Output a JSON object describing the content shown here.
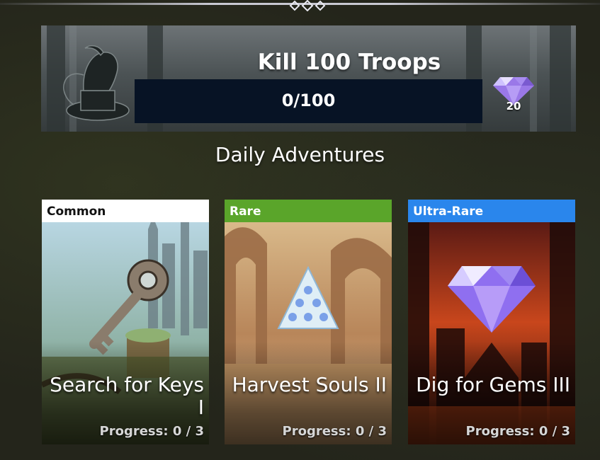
{
  "top_bar": {
    "ornament_icon": "diamond-ornament-icon"
  },
  "quest": {
    "title": "Kill 100 Troops",
    "progress_text": "0/100",
    "progress_fraction": 0,
    "reward": {
      "icon": "gem-icon",
      "count": "20"
    },
    "art_icon": "gargoyle-statue-icon"
  },
  "section_title": "Daily Adventures",
  "cards": [
    {
      "rarity": "Common",
      "rarity_bg": "#ffffff",
      "rarity_fg": "#111111",
      "name": "Search for Keys I",
      "progress": "Progress: 0 / 3",
      "icon": "key-icon"
    },
    {
      "rarity": "Rare",
      "rarity_bg": "#5aa52a",
      "rarity_fg": "#ffffff",
      "name": "Harvest Souls II",
      "progress": "Progress: 0 / 3",
      "icon": "soul-pyramid-icon"
    },
    {
      "rarity": "Ultra-Rare",
      "rarity_bg": "#2a86ec",
      "rarity_fg": "#ffffff",
      "name": "Dig for Gems III",
      "progress": "Progress: 0 / 3",
      "icon": "gem-icon"
    }
  ]
}
